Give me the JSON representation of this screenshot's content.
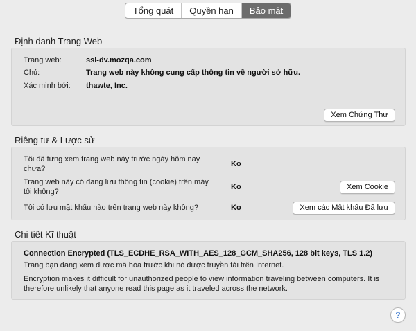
{
  "tabs": [
    {
      "label": "Tổng quát"
    },
    {
      "label": "Quyền hạn"
    },
    {
      "label": "Bảo mật"
    }
  ],
  "identity": {
    "title": "Định danh Trang Web",
    "website_label": "Trang web:",
    "website_value": "ssl-dv.mozqa.com",
    "owner_label": "Chủ:",
    "owner_value": "Trang web này không cung cấp thông tin về người sở hữu.",
    "verifier_label": "Xác minh bởi:",
    "verifier_value": "thawte, Inc.",
    "view_cert_button": "Xem Chứng Thư"
  },
  "privacy": {
    "title": "Riêng tư & Lược sử",
    "q1_line1": "Tôi đã từng xem trang web này trước ngày hôm nay",
    "q1_line2": "chưa?",
    "q1_answer": "Ko",
    "q2_line1": "Trang web này có đang lưu thông tin (cookie) trên máy",
    "q2_line2": "tôi không?",
    "q2_answer": "Ko",
    "view_cookie_button": "Xem Cookie",
    "q3": "Tôi có lưu mật khẩu nào trên trang web này không?",
    "q3_answer": "Ko",
    "view_passwords_button": "Xem các Mật khẩu Đã lưu"
  },
  "technical": {
    "title": "Chi tiết Kĩ thuật",
    "connection": "Connection Encrypted (TLS_ECDHE_RSA_WITH_AES_128_GCM_SHA256, 128 bit keys, TLS 1.2)",
    "encrypted_note": "Trang bạn đang xem được mã hóa trước khi nó được truyền tải trên Internet.",
    "explain_line1": "Encryption makes it difficult for unauthorized people to view information traveling between computers. It is",
    "explain_line2": "therefore unlikely that anyone read this page as it traveled across the network."
  },
  "help_symbol": "?",
  "colors": {
    "active_tab": "#6c6c6c",
    "help_glyph": "#1f65c6"
  }
}
